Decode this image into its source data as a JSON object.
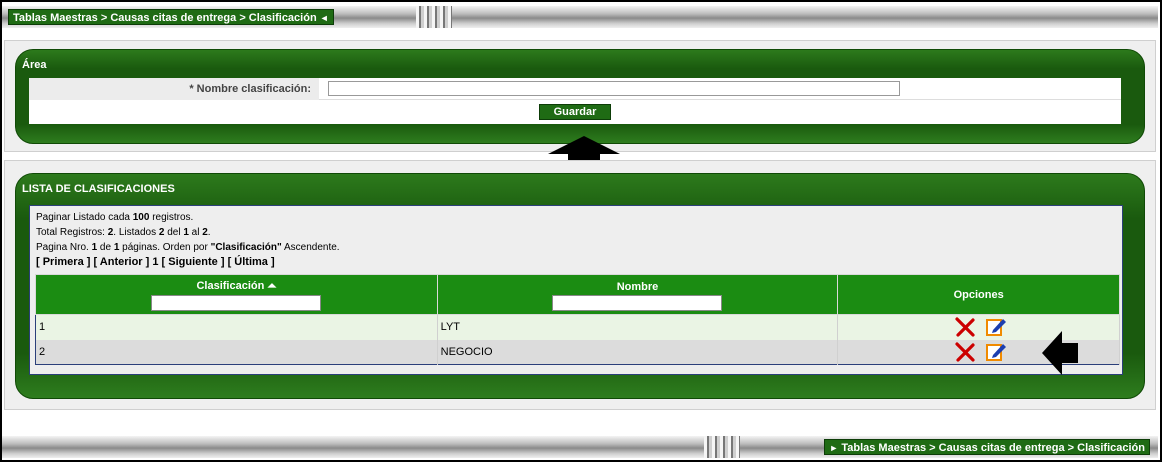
{
  "breadcrumb": {
    "text": "Tablas Maestras > Causas citas de entrega > Clasificación"
  },
  "area": {
    "title": "Área",
    "field_label": "* Nombre clasificación:",
    "field_value": "",
    "save_label": "Guardar"
  },
  "lista": {
    "title": "LISTA DE CLASIFICACIONES",
    "info": {
      "line1_a": "Paginar Listado cada ",
      "line1_b": "100",
      "line1_c": " registros.",
      "line2_a": "Total Registros: ",
      "line2_b": "2",
      "line2_c": ". Listados ",
      "line2_d": "2",
      "line2_e": " del ",
      "line2_f": "1",
      "line2_g": " al ",
      "line2_h": "2",
      "line2_i": ".",
      "line3_a": "Pagina Nro. ",
      "line3_b": "1",
      "line3_c": " de ",
      "line3_d": "1",
      "line3_e": " páginas. Orden por ",
      "line3_f": "\"Clasificación\"",
      "line3_g": " Ascendente."
    },
    "nav": {
      "first": "[ Primera ]",
      "prev": "[ Anterior ]",
      "page": "1",
      "next": "[ Siguiente ]",
      "last": "[ Última ]"
    },
    "columns": {
      "clasificacion": "Clasificación",
      "nombre": "Nombre",
      "opciones": "Opciones"
    },
    "rows": [
      {
        "clasificacion": "1",
        "nombre": "LYT"
      },
      {
        "clasificacion": "2",
        "nombre": "NEGOCIO"
      }
    ]
  },
  "colors": {
    "accent": "#1f6b14",
    "header": "#1b8c12",
    "delete": "#cc0000",
    "edit": "#f08a00"
  }
}
